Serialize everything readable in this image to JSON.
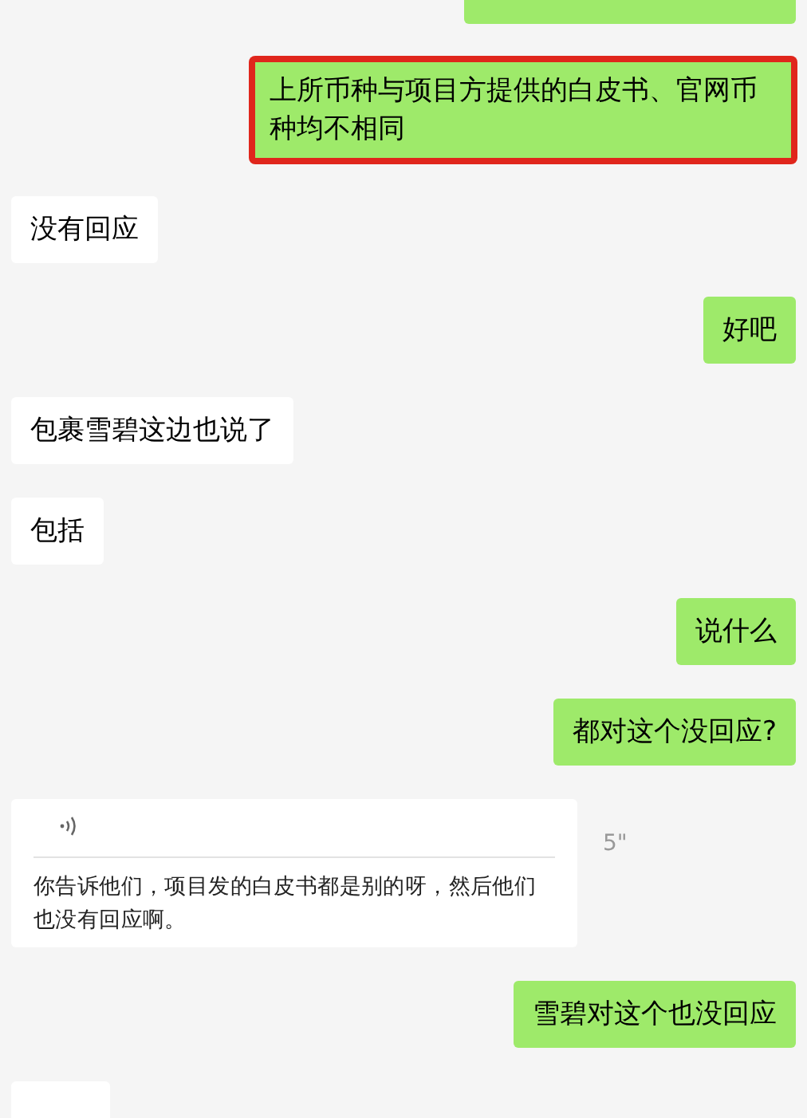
{
  "messages": [
    {
      "kind": "clipped",
      "outgoing": true
    },
    {
      "kind": "text",
      "outgoing": true,
      "text": "上所币种与项目方提供的白皮书、官网币种均不相同",
      "highlighted": true
    },
    {
      "kind": "text",
      "outgoing": false,
      "text": "没有回应",
      "highlighted": false
    },
    {
      "kind": "text",
      "outgoing": true,
      "text": "好吧",
      "highlighted": false
    },
    {
      "kind": "text",
      "outgoing": false,
      "text": "包裹雪碧这边也说了",
      "highlighted": false
    },
    {
      "kind": "text",
      "outgoing": false,
      "text": "包括",
      "highlighted": false
    },
    {
      "kind": "text",
      "outgoing": true,
      "text": "说什么",
      "highlighted": false
    },
    {
      "kind": "text",
      "outgoing": true,
      "text": "都对这个没回应?",
      "highlighted": false
    },
    {
      "kind": "voice",
      "outgoing": false,
      "duration": "5\"",
      "transcript": "你告诉他们，项目发的白皮书都是别的呀，然后他们也没有回应啊。"
    },
    {
      "kind": "text",
      "outgoing": true,
      "text": "雪碧对这个也没回应",
      "highlighted": false
    },
    {
      "kind": "clipped",
      "outgoing": false
    }
  ]
}
